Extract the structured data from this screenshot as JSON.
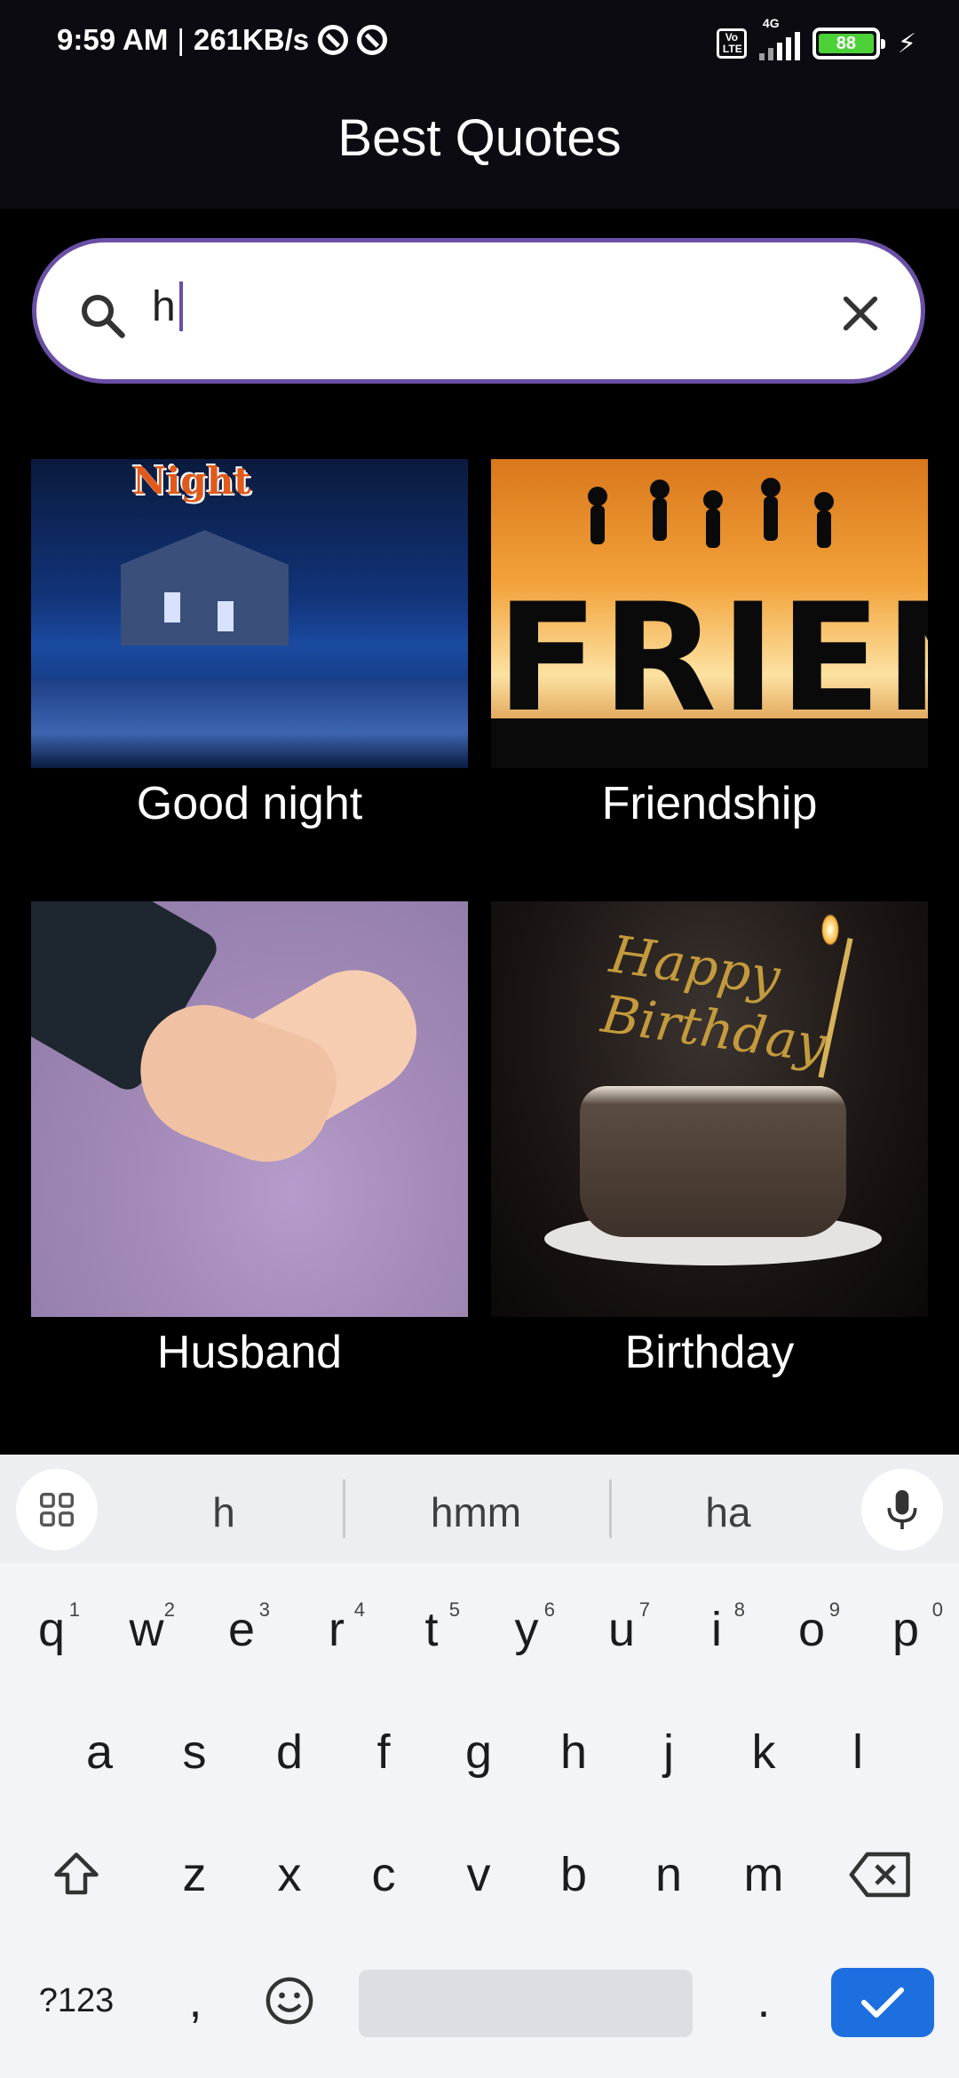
{
  "status_bar": {
    "time": "9:59 AM",
    "separator": "|",
    "speed": "261KB/s",
    "network_type": "4G",
    "volte": "Vo LTE",
    "battery_level": "88"
  },
  "app_bar": {
    "title": "Best Quotes"
  },
  "search": {
    "value": "h"
  },
  "categories": [
    {
      "label": "Good night",
      "image_badge": "Night"
    },
    {
      "label": "Friendship",
      "image_text": "FRIEND"
    },
    {
      "label": "Husband"
    },
    {
      "label": "Birthday",
      "image_text": "Happy Birthday"
    }
  ],
  "keyboard": {
    "suggestions": [
      "h",
      "hmm",
      "ha"
    ],
    "row1": [
      {
        "key": "q",
        "hint": "1"
      },
      {
        "key": "w",
        "hint": "2"
      },
      {
        "key": "e",
        "hint": "3"
      },
      {
        "key": "r",
        "hint": "4"
      },
      {
        "key": "t",
        "hint": "5"
      },
      {
        "key": "y",
        "hint": "6"
      },
      {
        "key": "u",
        "hint": "7"
      },
      {
        "key": "i",
        "hint": "8"
      },
      {
        "key": "o",
        "hint": "9"
      },
      {
        "key": "p",
        "hint": "0"
      }
    ],
    "row2": [
      "a",
      "s",
      "d",
      "f",
      "g",
      "h",
      "j",
      "k",
      "l"
    ],
    "row3": [
      "z",
      "x",
      "c",
      "v",
      "b",
      "n",
      "m"
    ],
    "symbols_label": "?123",
    "comma": ",",
    "period": "."
  },
  "colors": {
    "accent": "#6a4fa5",
    "keyboard_enter": "#1d6fe0",
    "app_bar": "#0c0b12",
    "battery": "#4cd137"
  }
}
